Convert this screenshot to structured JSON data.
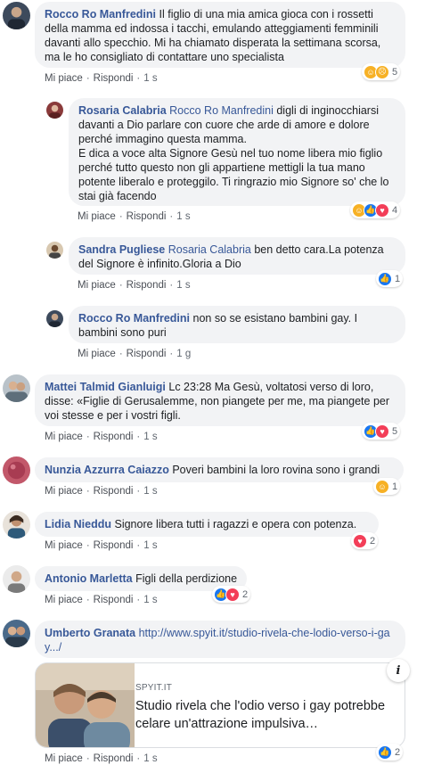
{
  "comments": [
    {
      "author": "Rocco Ro Manfredini",
      "text": "Il figlio di una mia amica gioca con i rossetti della mamma ed indossa i tacchi, emulando atteggiamenti femminili davanti allo specchio. Mi ha chiamato disperata la settimana scorsa, ma le ho consigliato di contattare uno specialista",
      "like_label": "Mi piace",
      "reply_label": "Rispondi",
      "time": "1 s",
      "reactions": [
        "haha",
        "sad"
      ],
      "reaction_count": "5"
    },
    {
      "author": "Rosaria Calabria",
      "mention": "Rocco Ro Manfredini",
      "text": "digli di inginocchiarsi davanti a Dio parlare con cuore che arde di amore e dolore perché immagino questa mamma.\nE dica a voce alta Signore Gesù nel tuo nome libera mio figlio perché tutto questo non gli appartiene mettigli la tua mano potente liberalo e proteggilo. Ti ringrazio mio Signore so' che lo stai già facendo",
      "like_label": "Mi piace",
      "reply_label": "Rispondi",
      "time": "1 s",
      "reactions": [
        "haha",
        "like",
        "love"
      ],
      "reaction_count": "4"
    },
    {
      "author": "Sandra Pugliese",
      "mention": "Rosaria Calabria",
      "text": "ben detto cara.La potenza del Signore è infinito.Gloria a Dio",
      "like_label": "Mi piace",
      "reply_label": "Rispondi",
      "time": "1 s",
      "reactions": [
        "like"
      ],
      "reaction_count": "1"
    },
    {
      "author": "Rocco Ro Manfredini",
      "text": "non so se esistano bambini gay. I bambini sono puri",
      "like_label": "Mi piace",
      "reply_label": "Rispondi",
      "time": "1 g"
    },
    {
      "author": "Mattei Talmid Gianluigi",
      "text": "Lc 23:28 Ma Gesù, voltatosi verso di loro, disse: «Figlie di Gerusalemme, non piangete per me, ma piangete per voi stesse e per i vostri figli.",
      "like_label": "Mi piace",
      "reply_label": "Rispondi",
      "time": "1 s",
      "reactions": [
        "like",
        "love"
      ],
      "reaction_count": "5"
    },
    {
      "author": "Nunzia Azzurra Caiazzo",
      "text": "Poveri bambini la loro rovina sono i grandi",
      "like_label": "Mi piace",
      "reply_label": "Rispondi",
      "time": "1 s",
      "reactions": [
        "haha"
      ],
      "reaction_count": "1"
    },
    {
      "author": "Lidia Nieddu",
      "text": "Signore libera tutti i ragazzi e opera con potenza.",
      "like_label": "Mi piace",
      "reply_label": "Rispondi",
      "time": "1 s",
      "reactions": [
        "love"
      ],
      "reaction_count": "2"
    },
    {
      "author": "Antonio Marletta",
      "text": "Figli della perdizione",
      "like_label": "Mi piace",
      "reply_label": "Rispondi",
      "time": "1 s",
      "reactions": [
        "like",
        "love"
      ],
      "reaction_count": "2"
    },
    {
      "author": "Umberto Granata",
      "link": "http://www.spyit.it/studio-rivela-che-lodio-verso-i-gay.../",
      "preview_site": "SPYIT.IT",
      "preview_title": "Studio rivela che l'odio verso i gay potrebbe celare un'attrazione impulsiva…",
      "info_label": "i",
      "like_label": "Mi piace",
      "reply_label": "Rispondi",
      "time": "1 s",
      "reactions": [
        "like"
      ],
      "reaction_count": "2"
    }
  ],
  "colors": {
    "name": "#385898",
    "bubble": "#f2f3f5",
    "like": "#1877f2",
    "love": "#f33e58",
    "haha": "#f7b125"
  }
}
